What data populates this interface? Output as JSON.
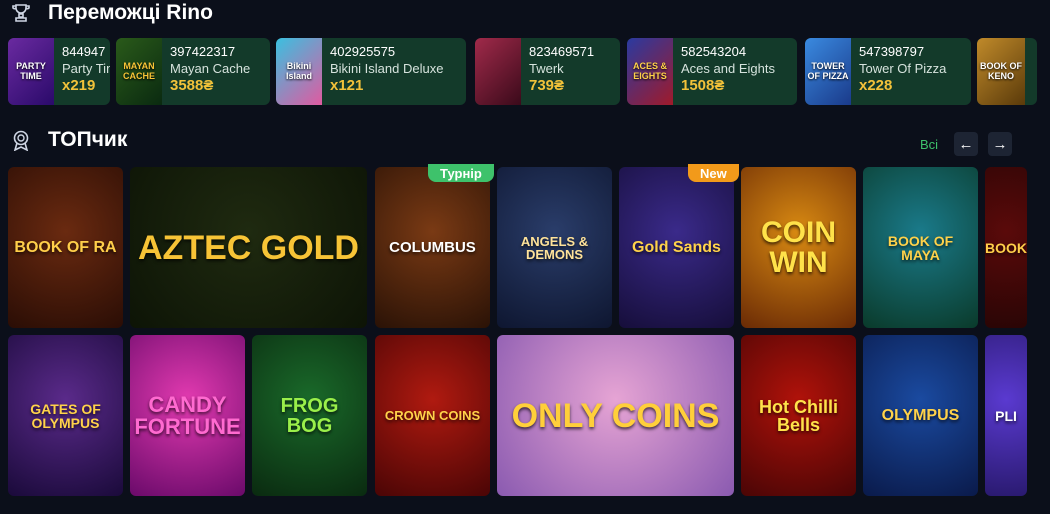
{
  "winners": {
    "title": "Переможці Rino",
    "items": [
      {
        "thumb": "PARTY TIME",
        "uid": "844947",
        "game": "Party Tim",
        "amount": "x219"
      },
      {
        "thumb": "MAYAN CACHE",
        "uid": "397422317",
        "game": "Mayan Cache",
        "amount": "3588₴"
      },
      {
        "thumb": "Bikini Island",
        "uid": "402925575",
        "game": "Bikini Island Deluxe",
        "amount": "x121"
      },
      {
        "thumb": "",
        "uid": "823469571",
        "game": "Twerk",
        "amount": "739₴"
      },
      {
        "thumb": "ACES & EIGHTS",
        "uid": "582543204",
        "game": "Aces and Eights",
        "amount": "1508₴"
      },
      {
        "thumb": "TOWER OF PIZZA",
        "uid": "547398797",
        "game": "Tower Of Pizza",
        "amount": "x228"
      },
      {
        "thumb": "BOOK OF KENO",
        "uid": "",
        "game": "",
        "amount": ""
      }
    ]
  },
  "top": {
    "title": "ТОПчик",
    "all_label": "Всі",
    "prev_icon": "arrow-left-icon",
    "next_icon": "arrow-right-icon",
    "prev_glyph": "←",
    "next_glyph": "→"
  },
  "badges": {
    "tournament": "Турнір",
    "new": "New"
  },
  "games": [
    {
      "name": "BOOK OF RA",
      "color1": "#6a2a10",
      "color2": "#2a0d05",
      "text": "#ffcf4a"
    },
    {
      "name": "AZTEC GOLD",
      "color1": "#1f2a10",
      "color2": "#0d1406",
      "text": "#f7c436"
    },
    {
      "name": "COLUMBUS",
      "color1": "#7a3a14",
      "color2": "#2a1206",
      "text": "#ffffff"
    },
    {
      "name": "ANGELS & DEMONS",
      "color1": "#2a3d6a",
      "color2": "#0e1630",
      "text": "#ffe39a"
    },
    {
      "name": "Gold Sands",
      "color1": "#3a2a8a",
      "color2": "#160e3a",
      "text": "#ffd24a"
    },
    {
      "name": "COIN WIN",
      "color1": "#d98a12",
      "color2": "#6a2a05",
      "text": "#ffe24a"
    },
    {
      "name": "BOOK OF MAYA",
      "color1": "#1a7a8a",
      "color2": "#0a3a2a",
      "text": "#ffd24a"
    },
    {
      "name": "BOOK",
      "color1": "#5a0a0a",
      "color2": "#2a0505",
      "text": "#ffcf4a"
    },
    {
      "name": "GATES OF OLYMPUS",
      "color1": "#5a2a8a",
      "color2": "#1a0a3a",
      "text": "#ffd24a"
    },
    {
      "name": "CANDY FORTUNE",
      "color1": "#e23ab0",
      "color2": "#6a0a6a",
      "text": "#ff6ad0"
    },
    {
      "name": "FROG BOG",
      "color1": "#1a6a2a",
      "color2": "#0a2a10",
      "text": "#9aef4a"
    },
    {
      "name": "CROWN COINS",
      "color1": "#b01a10",
      "color2": "#4a0505",
      "text": "#ffd24a"
    },
    {
      "name": "ONLY COINS",
      "color1": "#e6a4d4",
      "color2": "#8a5ab0",
      "text": "#ffcf3a"
    },
    {
      "name": "Hot Chilli Bells",
      "color1": "#b0120a",
      "color2": "#4a0505",
      "text": "#ffe24a"
    },
    {
      "name": "OLYMPUS",
      "color1": "#1a4aa0",
      "color2": "#0a1a4a",
      "text": "#ffd24a"
    },
    {
      "name": "PLI",
      "color1": "#5a3ad0",
      "color2": "#2a1a70",
      "text": "#ffffff"
    }
  ],
  "colors": {
    "accent": "#3ec26b",
    "amount": "#f2c23a",
    "tournament": "#3ec26b",
    "new": "#f29a1a",
    "card_bg": "#133a2a"
  }
}
